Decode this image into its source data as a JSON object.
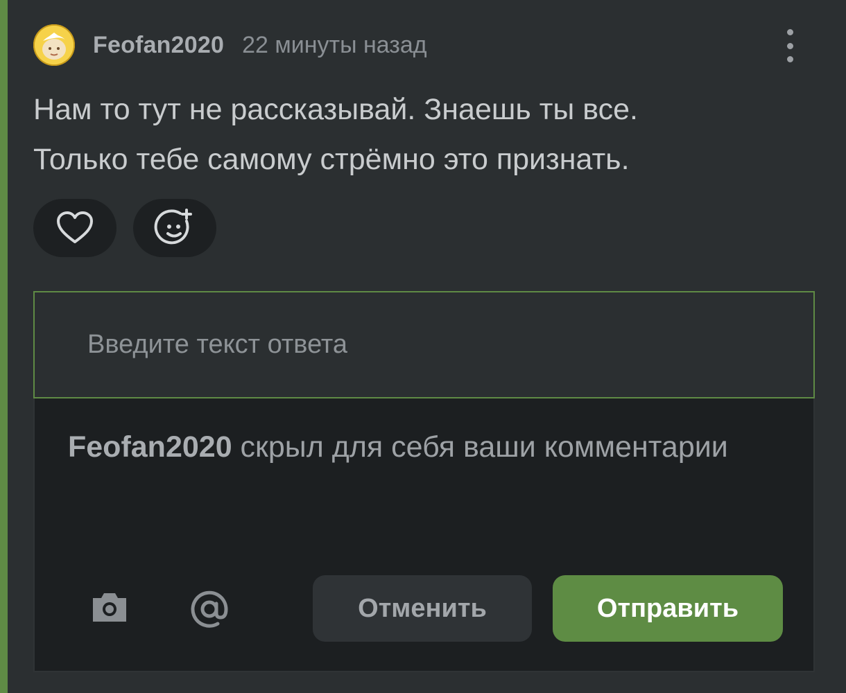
{
  "comment": {
    "username": "Feofan2020",
    "timestamp": "22 минуты назад",
    "text_lines": [
      "Нам то тут не рассказывай. Знаешь ты все.",
      "Только тебе самому стрёмно это признать."
    ]
  },
  "icons": {
    "more": "vertical-dots-icon",
    "like": "heart-icon",
    "react": "smiley-plus-icon",
    "camera": "camera-icon",
    "mention": "at-sign-icon"
  },
  "reply": {
    "placeholder": "Введите текст ответа",
    "value": "",
    "notice_user": "Feofan2020",
    "notice_text": " скрыл для себя ваши комментарии",
    "cancel_label": "Отменить",
    "send_label": "Отправить"
  },
  "colors": {
    "accent": "#5e8c44",
    "background": "#2b2f31",
    "panel": "#1c1f21"
  }
}
